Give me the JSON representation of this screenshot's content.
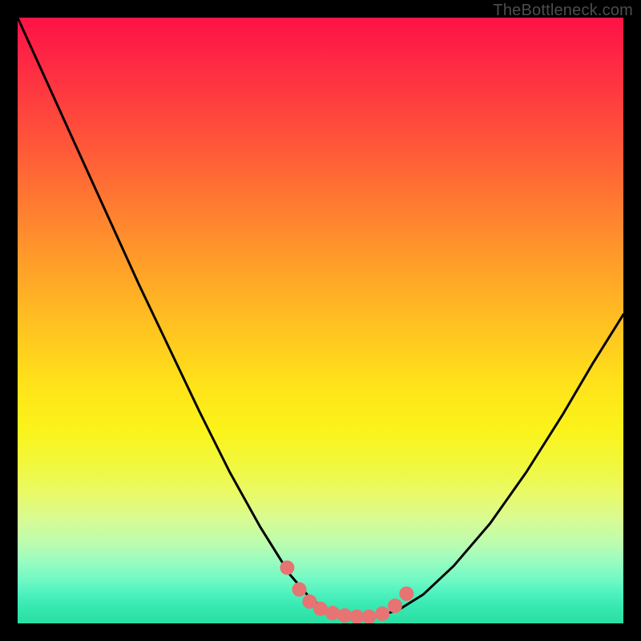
{
  "watermark": "TheBottleneck.com",
  "colors": {
    "frame": "#000000",
    "curve_stroke": "#000000",
    "marker_fill": "#e77373",
    "gradient_top": "#fe1246",
    "gradient_bottom": "#29dfa3"
  },
  "chart_data": {
    "type": "line",
    "title": "",
    "xlabel": "",
    "ylabel": "",
    "xlim": [
      0,
      100
    ],
    "ylim": [
      0,
      100
    ],
    "grid": false,
    "legend": false,
    "x": [
      0,
      5,
      10,
      15,
      20,
      25,
      30,
      35,
      40,
      45,
      48,
      50,
      52,
      55,
      58,
      60,
      63,
      67,
      72,
      78,
      84,
      90,
      95,
      100
    ],
    "y": [
      100,
      89,
      78,
      67,
      56,
      45.5,
      35,
      25,
      16,
      8,
      4.5,
      2.8,
      1.8,
      1.1,
      1.05,
      1.3,
      2.3,
      4.8,
      9.5,
      16.5,
      25,
      34.5,
      43,
      51
    ],
    "markers": {
      "x": [
        44.5,
        46.5,
        48.2,
        50,
        52,
        54,
        56,
        58,
        60.2,
        62.3,
        64.2
      ],
      "y": [
        9.2,
        5.6,
        3.6,
        2.4,
        1.7,
        1.3,
        1.1,
        1.1,
        1.6,
        2.9,
        4.9
      ]
    },
    "annotations": []
  }
}
